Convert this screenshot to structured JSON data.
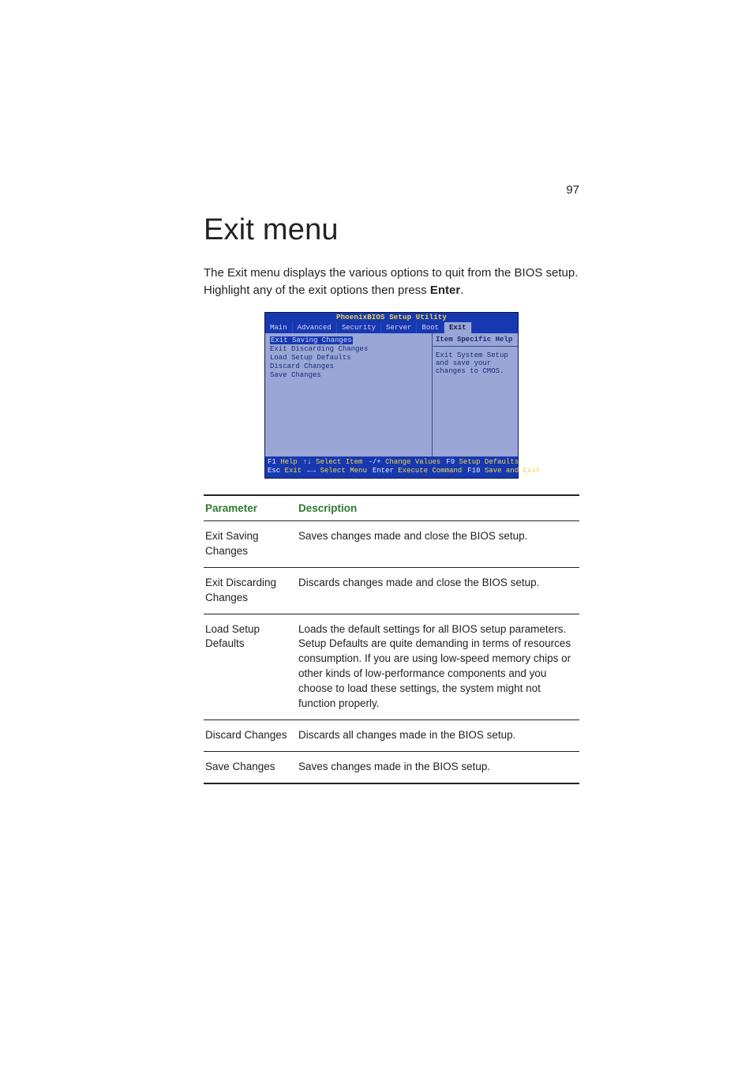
{
  "page_number": "97",
  "title": "Exit menu",
  "intro_part1": "The Exit menu displays the various options to quit from the BIOS setup. Highlight any of the exit options then press ",
  "intro_bold": "Enter",
  "intro_part2": ".",
  "bios": {
    "title": "PhoenixBIOS Setup Utility",
    "tabs": [
      "Main",
      "Advanced",
      "Security",
      "Server",
      "Boot",
      "Exit"
    ],
    "active_tab": "Exit",
    "items": [
      "Exit Saving Changes",
      "Exit Discarding Changes",
      "Load Setup Defaults",
      "Discard Changes",
      "Save Changes"
    ],
    "help_title": "Item Specific Help",
    "help_body": "Exit System Setup and save your changes to CMOS.",
    "keys_row1": [
      {
        "key": "F1",
        "act": "Help"
      },
      {
        "key": "↑↓",
        "act": "Select Item"
      },
      {
        "key": "-/+",
        "act": "Change Values"
      },
      {
        "key": "F9",
        "act": "Setup Defaults"
      }
    ],
    "keys_row2": [
      {
        "key": "Esc",
        "act": "Exit"
      },
      {
        "key": "←→",
        "act": "Select Menu"
      },
      {
        "key": "Enter",
        "act": "Execute Command"
      },
      {
        "key": "F10",
        "act": "Save and Exit"
      }
    ]
  },
  "table": {
    "head_param": "Parameter",
    "head_desc": "Description",
    "rows": [
      {
        "param": "Exit Saving Changes",
        "desc": "Saves changes made and close the BIOS setup."
      },
      {
        "param": "Exit Discarding Changes",
        "desc": "Discards changes made and close the BIOS setup."
      },
      {
        "param": "Load Setup Defaults",
        "desc": "Loads the default settings for all BIOS setup parameters. Setup Defaults are quite demanding in terms of resources consumption.  If you are using low-speed memory chips or other kinds of low-performance components and you choose to load these settings, the system might not function properly."
      },
      {
        "param": "Discard Changes",
        "desc": "Discards all changes made in the BIOS setup."
      },
      {
        "param": "Save Changes",
        "desc": "Saves changes made in the BIOS setup."
      }
    ]
  }
}
